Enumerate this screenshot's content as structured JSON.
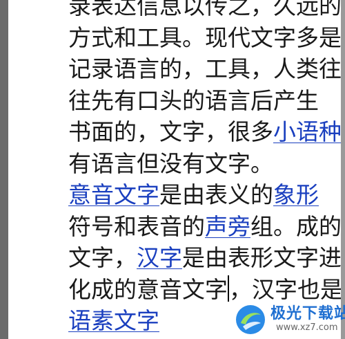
{
  "document": {
    "lines": [
      [
        {
          "text": "录表达信息以传之，久远的"
        }
      ],
      [
        {
          "text": "方式和工具。现代文字多是"
        }
      ],
      [
        {
          "text": "记录语言的，工具，人类往"
        }
      ],
      [
        {
          "text": "往先有口头的语言后产生"
        }
      ],
      [
        {
          "text": "书面的，文字，很多"
        },
        {
          "text": "小语种",
          "link": true
        },
        {
          "text": "，"
        }
      ],
      [
        {
          "text": "有语言但没有文字。"
        }
      ],
      [
        {
          "text": "意音文字",
          "link": true
        },
        {
          "text": "是由表义的"
        },
        {
          "text": "象形",
          "link": true
        }
      ],
      [
        {
          "text": "符号和表音的"
        },
        {
          "text": "声旁",
          "link": true
        },
        {
          "text": "组。成的"
        }
      ],
      [
        {
          "text": "文字，"
        },
        {
          "text": "汉字",
          "link": true
        },
        {
          "text": "是由表形文字进"
        }
      ],
      [
        {
          "text": "化成的意音文字"
        },
        {
          "caret": true
        },
        {
          "text": "，汉字也是"
        }
      ],
      [
        {
          "text": "语素文字",
          "link": true
        }
      ]
    ]
  },
  "colors": {
    "text": "#1a1a1a",
    "link": "#1a3fbf",
    "gutter": "#6b6b6b",
    "watermark_blue": "#1f6fd1"
  },
  "watermark": {
    "title": "极光下载站",
    "url": "www.xz7.com",
    "logo_icon": "aurora-swirl-logo"
  }
}
